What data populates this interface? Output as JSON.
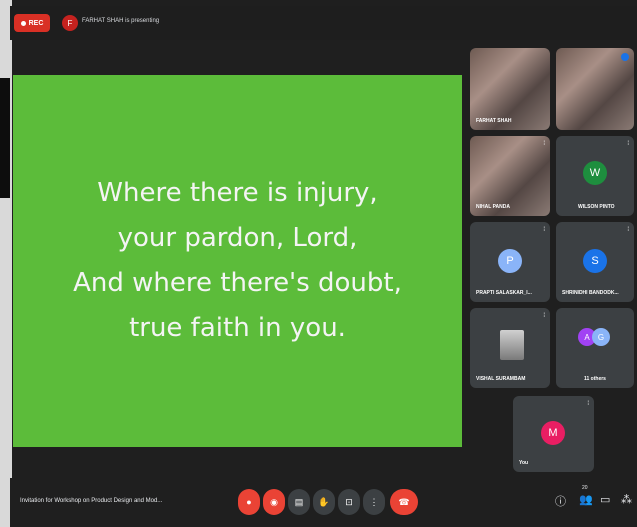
{
  "recording": {
    "label": "REC"
  },
  "presenter": {
    "initial": "F",
    "status_text": "FARHAT SHAH is presenting"
  },
  "slide": {
    "lines": [
      "Where there is injury,",
      "your pardon, Lord,",
      "And where there's doubt,",
      "true faith in you."
    ],
    "background_color": "#5cbc3a"
  },
  "participants": [
    {
      "name": "FARHAT SHAH",
      "type": "video"
    },
    {
      "name": "",
      "type": "video"
    },
    {
      "name": "NIHAL PANDA",
      "type": "video"
    },
    {
      "name": "WILSON PINTO",
      "type": "avatar",
      "initial": "W",
      "color": "#1e8e3e"
    },
    {
      "name": "PRAPTI SALASKAR_I...",
      "type": "avatar",
      "initial": "P",
      "color": "#8ab4f8"
    },
    {
      "name": "SHRINIDHI BANDODK...",
      "type": "avatar",
      "initial": "S",
      "color": "#1a73e8"
    },
    {
      "name": "VISHAL SURAMBAM",
      "type": "screen"
    },
    {
      "name": "11 others",
      "type": "group",
      "initials": [
        "A",
        "G"
      ]
    },
    {
      "name": "You",
      "type": "avatar",
      "initial": "M",
      "color": "#e91e63"
    }
  ],
  "bottom": {
    "meeting_title": "Invitation for Workshop on Product Design and Mod...",
    "participant_count": "20",
    "controls": {
      "mic": "mic-off-icon",
      "cam": "camera-off-icon",
      "cc": "captions-icon",
      "hand": "raise-hand-icon",
      "present": "present-icon",
      "more": "more-icon",
      "end": "end-call-icon"
    }
  },
  "colors": {
    "accent_red": "#ea4335",
    "panel": "#3c4043",
    "background": "#1f1f1f"
  }
}
